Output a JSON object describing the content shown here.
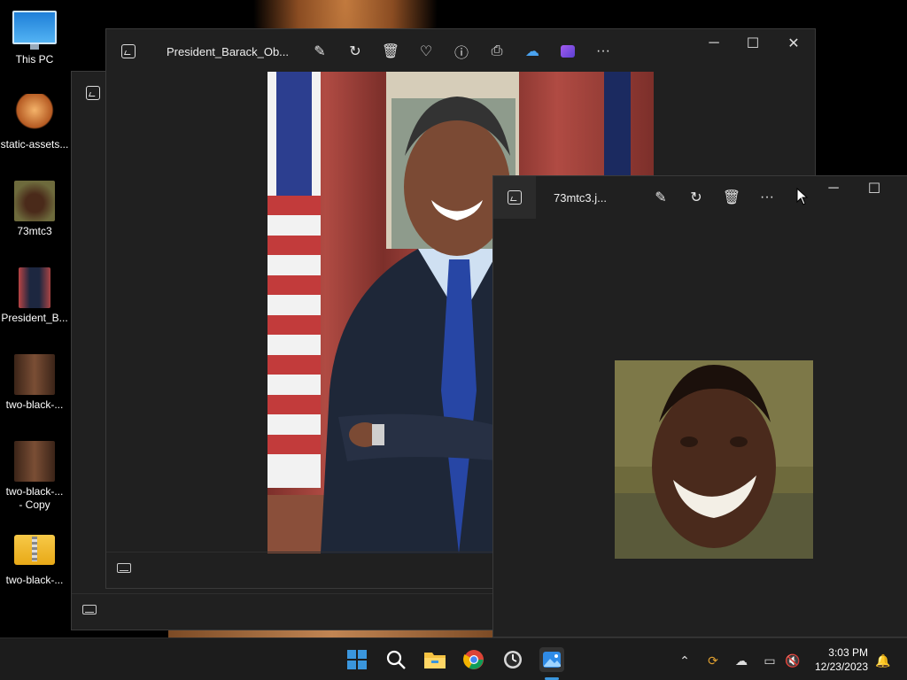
{
  "desktop": {
    "icons": [
      {
        "label": "This PC"
      },
      {
        "label": "static-assets..."
      },
      {
        "label": "73mtc3"
      },
      {
        "label": "President_B..."
      },
      {
        "label": "two-black-..."
      },
      {
        "label": "two-black-...\n- Copy"
      },
      {
        "label": "two-black-..."
      }
    ]
  },
  "window_back": {
    "title": "President_Barack_Ob..."
  },
  "window_front": {
    "title": "73mtc3.j..."
  },
  "taskbar": {
    "time": "3:03 PM",
    "date": "12/23/2023"
  },
  "colors": {
    "accent": "#3a96dd",
    "taskbar": "#1c1c1c",
    "window": "#202020"
  }
}
